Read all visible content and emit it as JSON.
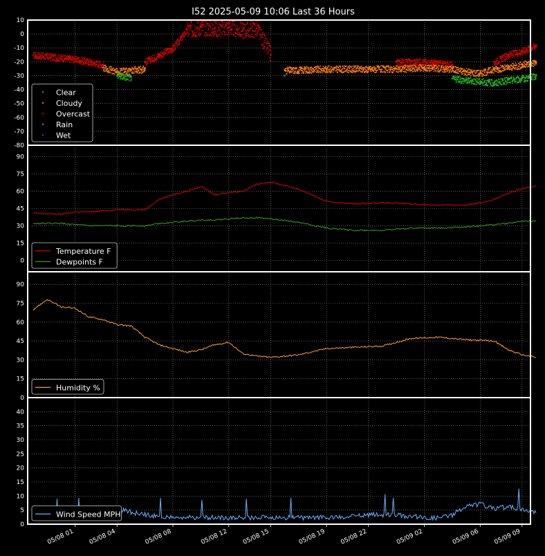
{
  "title": "I52 2025-05-09 10:06 Last 36 Hours",
  "x_ticks": [
    "05/08 01",
    "05/08 04",
    "05/08 08",
    "05/08 12",
    "05/08 15",
    "05/08 19",
    "05/08 22",
    "05/09 02",
    "05/09 06",
    "05/09 09"
  ],
  "colors": {
    "background": "#000000",
    "grid": "#9a9a9a",
    "clear": "#22b422",
    "cloudy": "#ff7f0e",
    "overcast": "#e00000",
    "rain": "#8a8a8a",
    "wet": "#1f4fd0",
    "temperature": "#e00000",
    "dewpoints": "#3aa01a",
    "humidity": "#ffa040",
    "wind": "#6fb0ff"
  },
  "chart_data": [
    {
      "type": "scatter",
      "panel": "sky",
      "ylim": [
        -80,
        10
      ],
      "yticks": [
        10,
        0,
        -10,
        -20,
        -30,
        -40,
        -50,
        -60,
        -70,
        -80
      ],
      "legend": [
        "Clear",
        "Cloudy",
        "Overcast",
        "Rain",
        "Wet"
      ],
      "x": [
        "05/07 22",
        "05/08 01",
        "05/08 03",
        "05/08 04",
        "05/08 05",
        "05/08 06",
        "05/08 07",
        "05/08 08",
        "05/08 09",
        "05/08 10",
        "05/08 11",
        "05/08 12",
        "05/08 13",
        "05/08 14",
        "05/08 15",
        "05/08 16",
        "05/08 19",
        "05/08 22",
        "05/09 00",
        "05/09 02",
        "05/09 04",
        "05/09 05",
        "05/09 06",
        "05/09 07",
        "05/09 08",
        "05/09 09",
        "05/09 10"
      ],
      "series": [
        {
          "name": "Overcast",
          "values": [
            -15,
            -18,
            -22,
            null,
            null,
            -20,
            -15,
            -10,
            3,
            5,
            4,
            5,
            3,
            4,
            -15,
            null,
            null,
            null,
            -20,
            -20,
            -22,
            null,
            null,
            -20,
            -15,
            -12,
            -8
          ]
        },
        {
          "name": "Cloudy",
          "values": [
            null,
            null,
            -24,
            -27,
            -26,
            -25,
            null,
            null,
            null,
            null,
            null,
            null,
            null,
            null,
            null,
            -26,
            -25,
            -25,
            -25,
            -24,
            -25,
            -27,
            -28,
            -25,
            -24,
            -22,
            -20
          ]
        },
        {
          "name": "Clear",
          "values": [
            null,
            null,
            null,
            -30,
            -31,
            null,
            null,
            null,
            null,
            null,
            null,
            null,
            null,
            null,
            null,
            -30,
            null,
            null,
            null,
            null,
            -32,
            -33,
            -34,
            -35,
            -33,
            -32,
            -30
          ]
        }
      ]
    },
    {
      "type": "line",
      "panel": "temperature",
      "ylim": [
        -10,
        100
      ],
      "yticks": [
        0,
        15,
        30,
        45,
        60,
        75,
        90
      ],
      "legend": [
        "Temperature F",
        "Dewpoints F"
      ],
      "x": [
        "05/07 22",
        "05/08 00",
        "05/08 01",
        "05/08 02",
        "05/08 03",
        "05/08 04",
        "05/08 05",
        "05/08 06",
        "05/08 07",
        "05/08 08",
        "05/08 09",
        "05/08 10",
        "05/08 11",
        "05/08 12",
        "05/08 13",
        "05/08 14",
        "05/08 15",
        "05/08 17",
        "05/08 19",
        "05/08 21",
        "05/08 23",
        "05/09 01",
        "05/09 03",
        "05/09 05",
        "05/09 06",
        "05/09 07",
        "05/09 08",
        "05/09 09",
        "05/09 10"
      ],
      "series": [
        {
          "name": "Temperature F",
          "values": [
            41,
            40,
            42,
            42,
            43,
            44,
            44,
            44,
            53,
            57,
            60,
            64,
            57,
            59,
            60,
            66,
            68,
            62,
            51,
            49,
            50,
            49,
            48,
            48,
            50,
            53,
            58,
            62,
            65
          ]
        },
        {
          "name": "Dewpoints F",
          "values": [
            32,
            32,
            31,
            30,
            30,
            30,
            30,
            30,
            32,
            33,
            34,
            35,
            35,
            36,
            37,
            37,
            36,
            33,
            28,
            26,
            26,
            28,
            28,
            29,
            30,
            31,
            32,
            34,
            34
          ]
        }
      ]
    },
    {
      "type": "line",
      "panel": "humidity",
      "ylim": [
        0,
        100
      ],
      "yticks": [
        0,
        15,
        30,
        45,
        60,
        75,
        90
      ],
      "legend": [
        "Humidity %"
      ],
      "x": [
        "05/07 22",
        "05/07 23",
        "05/08 00",
        "05/08 01",
        "05/08 02",
        "05/08 03",
        "05/08 04",
        "05/08 05",
        "05/08 06",
        "05/08 07",
        "05/08 08",
        "05/08 09",
        "05/08 10",
        "05/08 11",
        "05/08 12",
        "05/08 13",
        "05/08 14",
        "05/08 15",
        "05/08 17",
        "05/08 19",
        "05/08 21",
        "05/08 23",
        "05/09 01",
        "05/09 03",
        "05/09 05",
        "05/09 07",
        "05/09 08",
        "05/09 09",
        "05/09 10"
      ],
      "series": [
        {
          "name": "Humidity %",
          "values": [
            70,
            78,
            72,
            71,
            64,
            62,
            58,
            57,
            48,
            42,
            39,
            36,
            38,
            42,
            44,
            35,
            33,
            32,
            34,
            39,
            40,
            41,
            47,
            48,
            46,
            45,
            38,
            34,
            32
          ]
        }
      ]
    },
    {
      "type": "line",
      "panel": "wind",
      "ylim": [
        0,
        45
      ],
      "yticks": [
        0,
        5,
        10,
        15,
        20,
        25,
        30,
        35,
        40
      ],
      "legend": [
        "Wind Speed MPH"
      ],
      "x": [
        "05/07 22",
        "05/08 00",
        "05/08 02",
        "05/08 03",
        "05/08 04",
        "05/08 05",
        "05/08 06",
        "05/08 08",
        "05/08 10",
        "05/08 12",
        "05/08 14",
        "05/08 16",
        "05/08 18",
        "05/08 20",
        "05/08 22",
        "05/09 00",
        "05/09 02",
        "05/09 03",
        "05/09 04",
        "05/09 05",
        "05/09 06",
        "05/09 07",
        "05/09 08",
        "05/09 09",
        "05/09 10"
      ],
      "series": [
        {
          "name": "Wind Speed MPH",
          "values": [
            3,
            2,
            2,
            4,
            5,
            4,
            3,
            2,
            2,
            2,
            2,
            2,
            2,
            2,
            3,
            3,
            2,
            2,
            3,
            6,
            7,
            5,
            6,
            5,
            4
          ]
        }
      ]
    }
  ]
}
